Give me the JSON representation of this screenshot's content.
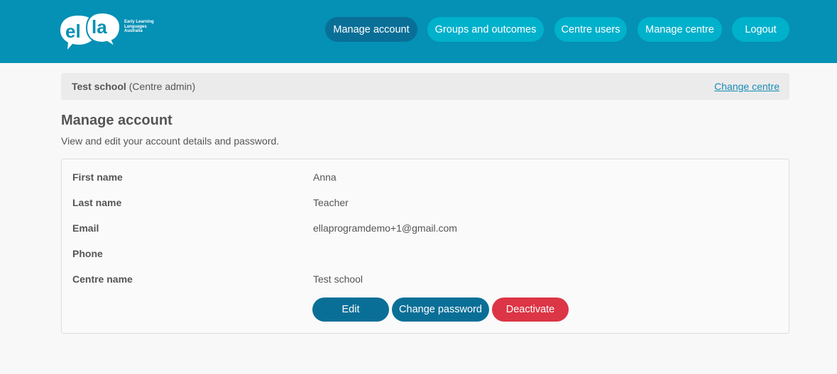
{
  "brand": {
    "logo_word": "ella",
    "logo_tagline": "Early Learning Languages Australia"
  },
  "nav": {
    "items": [
      {
        "label": "Manage account",
        "active": true
      },
      {
        "label": "Groups and outcomes",
        "active": false
      },
      {
        "label": "Centre users",
        "active": false
      },
      {
        "label": "Manage centre",
        "active": false
      },
      {
        "label": "Logout",
        "active": false
      }
    ]
  },
  "centre": {
    "school": "Test school",
    "role": "(Centre admin)",
    "change_link": "Change centre"
  },
  "page": {
    "title": "Manage account",
    "subtitle": "View and edit your account details and password."
  },
  "account": {
    "fields": [
      {
        "label": "First name",
        "value": "Anna"
      },
      {
        "label": "Last name",
        "value": "Teacher"
      },
      {
        "label": "Email",
        "value": "ellaprogramdemo+1@gmail.com"
      },
      {
        "label": "Phone",
        "value": ""
      },
      {
        "label": "Centre name",
        "value": "Test school"
      }
    ]
  },
  "actions": {
    "edit": "Edit",
    "change_password": "Change password",
    "deactivate": "Deactivate"
  },
  "colors": {
    "header_bg": "#0590b5",
    "nav_button": "#00b1cc",
    "nav_active": "#0a6f97",
    "primary_button": "#0a6f97",
    "danger_button": "#dc3545",
    "link": "#1a8bb5"
  }
}
